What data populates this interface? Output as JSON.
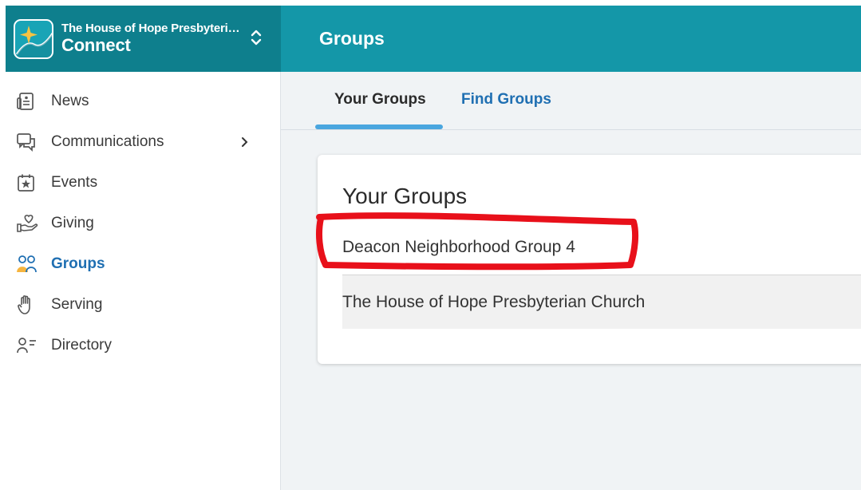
{
  "org": {
    "name": "The House of Hope Presbyterian Church",
    "app_name": "Connect",
    "logo_icon": "sparkle-logo-icon",
    "switcher_icon": "chevron-updown-icon"
  },
  "header": {
    "title": "Groups"
  },
  "sidebar": {
    "items": [
      {
        "label": "News",
        "icon": "news-icon",
        "active": false
      },
      {
        "label": "Communications",
        "icon": "chat-icon",
        "active": false,
        "has_submenu": true
      },
      {
        "label": "Events",
        "icon": "calendar-star-icon",
        "active": false
      },
      {
        "label": "Giving",
        "icon": "heart-hand-icon",
        "active": false
      },
      {
        "label": "Groups",
        "icon": "people-icon",
        "active": true
      },
      {
        "label": "Serving",
        "icon": "raised-hand-icon",
        "active": false
      },
      {
        "label": "Directory",
        "icon": "person-list-icon",
        "active": false
      }
    ]
  },
  "tabs": [
    {
      "label": "Your Groups",
      "selected": true
    },
    {
      "label": "Find Groups",
      "selected": false
    }
  ],
  "card": {
    "title": "Your Groups",
    "groups": [
      {
        "name": "Deacon Neighborhood Group 4",
        "highlighted": true
      },
      {
        "name": "The House of Hope Presbyterian Church",
        "highlighted": false
      }
    ]
  },
  "colors": {
    "org_bar": "#0e7f8d",
    "header_bar": "#1497a8",
    "active_nav": "#1f6fb2",
    "tab_underline": "#4aa6df",
    "annotation": "#e8101a"
  }
}
